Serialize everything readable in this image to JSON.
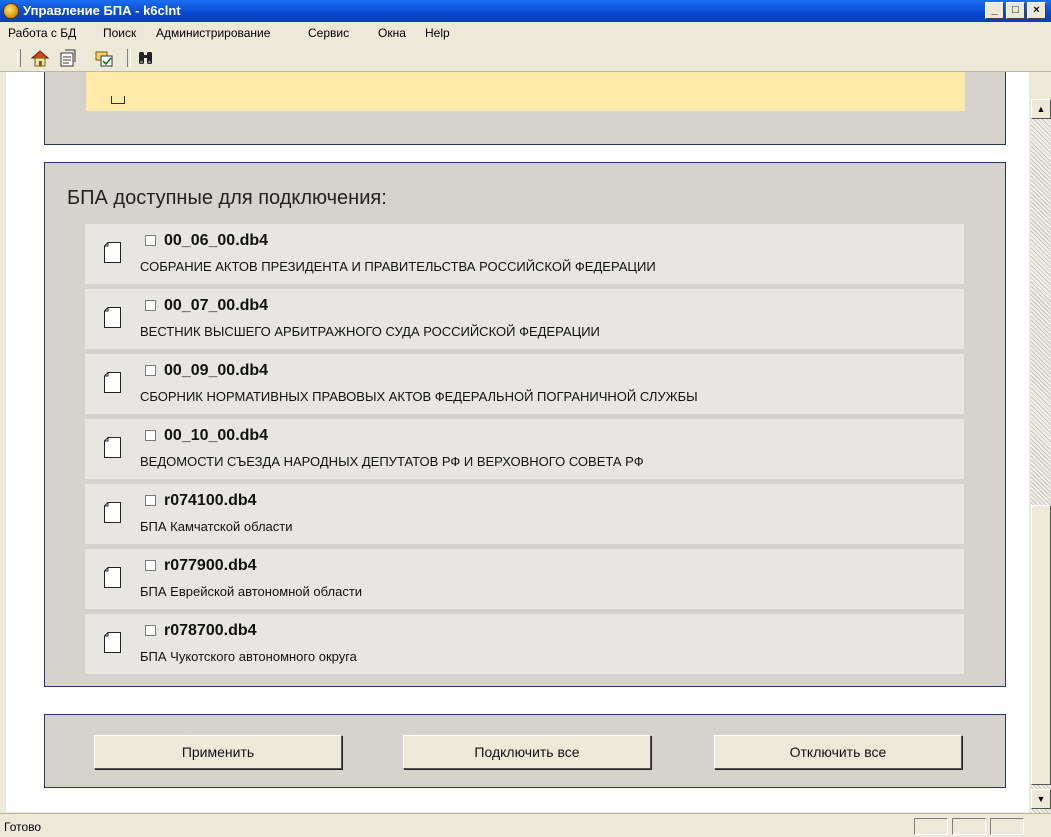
{
  "window": {
    "title": "Управление БПА - k6clnt"
  },
  "menu": {
    "items": [
      "Работа с БД",
      "Поиск",
      "Администрирование",
      "Сервис",
      "Окна",
      "Help"
    ]
  },
  "toolbar": {
    "buttons": [
      "home-icon",
      "database-icon",
      "select-icon",
      "binoculars-icon"
    ]
  },
  "available": {
    "title": "БПА доступные для подключения:",
    "items": [
      {
        "file": "00_06_00.db4",
        "desc": "СОБРАНИЕ АКТОВ ПРЕЗИДЕНТА И ПРАВИТЕЛЬСТВА РОССИЙСКОЙ ФЕДЕРАЦИИ",
        "checked": false
      },
      {
        "file": "00_07_00.db4",
        "desc": "ВЕСТНИК ВЫСШЕГО АРБИТРАЖНОГО СУДА РОССИЙСКОЙ ФЕДЕРАЦИИ",
        "checked": false
      },
      {
        "file": "00_09_00.db4",
        "desc": "СБОРНИК НОРМАТИВНЫХ ПРАВОВЫХ АКТОВ ФЕДЕРАЛЬНОЙ ПОГРАНИЧНОЙ СЛУЖБЫ",
        "checked": false
      },
      {
        "file": "00_10_00.db4",
        "desc": "ВЕДОМОСТИ СЪЕЗДА НАРОДНЫХ ДЕПУТАТОВ РФ И ВЕРХОВНОГО СОВЕТА РФ",
        "checked": false
      },
      {
        "file": "r074100.db4",
        "desc": "БПА Камчатской области",
        "checked": false
      },
      {
        "file": "r077900.db4",
        "desc": "БПА Еврейской автономной области",
        "checked": false
      },
      {
        "file": "r078700.db4",
        "desc": "БПА Чукотского автономного округа",
        "checked": false
      }
    ]
  },
  "actions": {
    "apply": "Применить",
    "connect_all": "Подключить все",
    "disconnect_all": "Отключить все"
  },
  "status": {
    "text": "Готово"
  }
}
